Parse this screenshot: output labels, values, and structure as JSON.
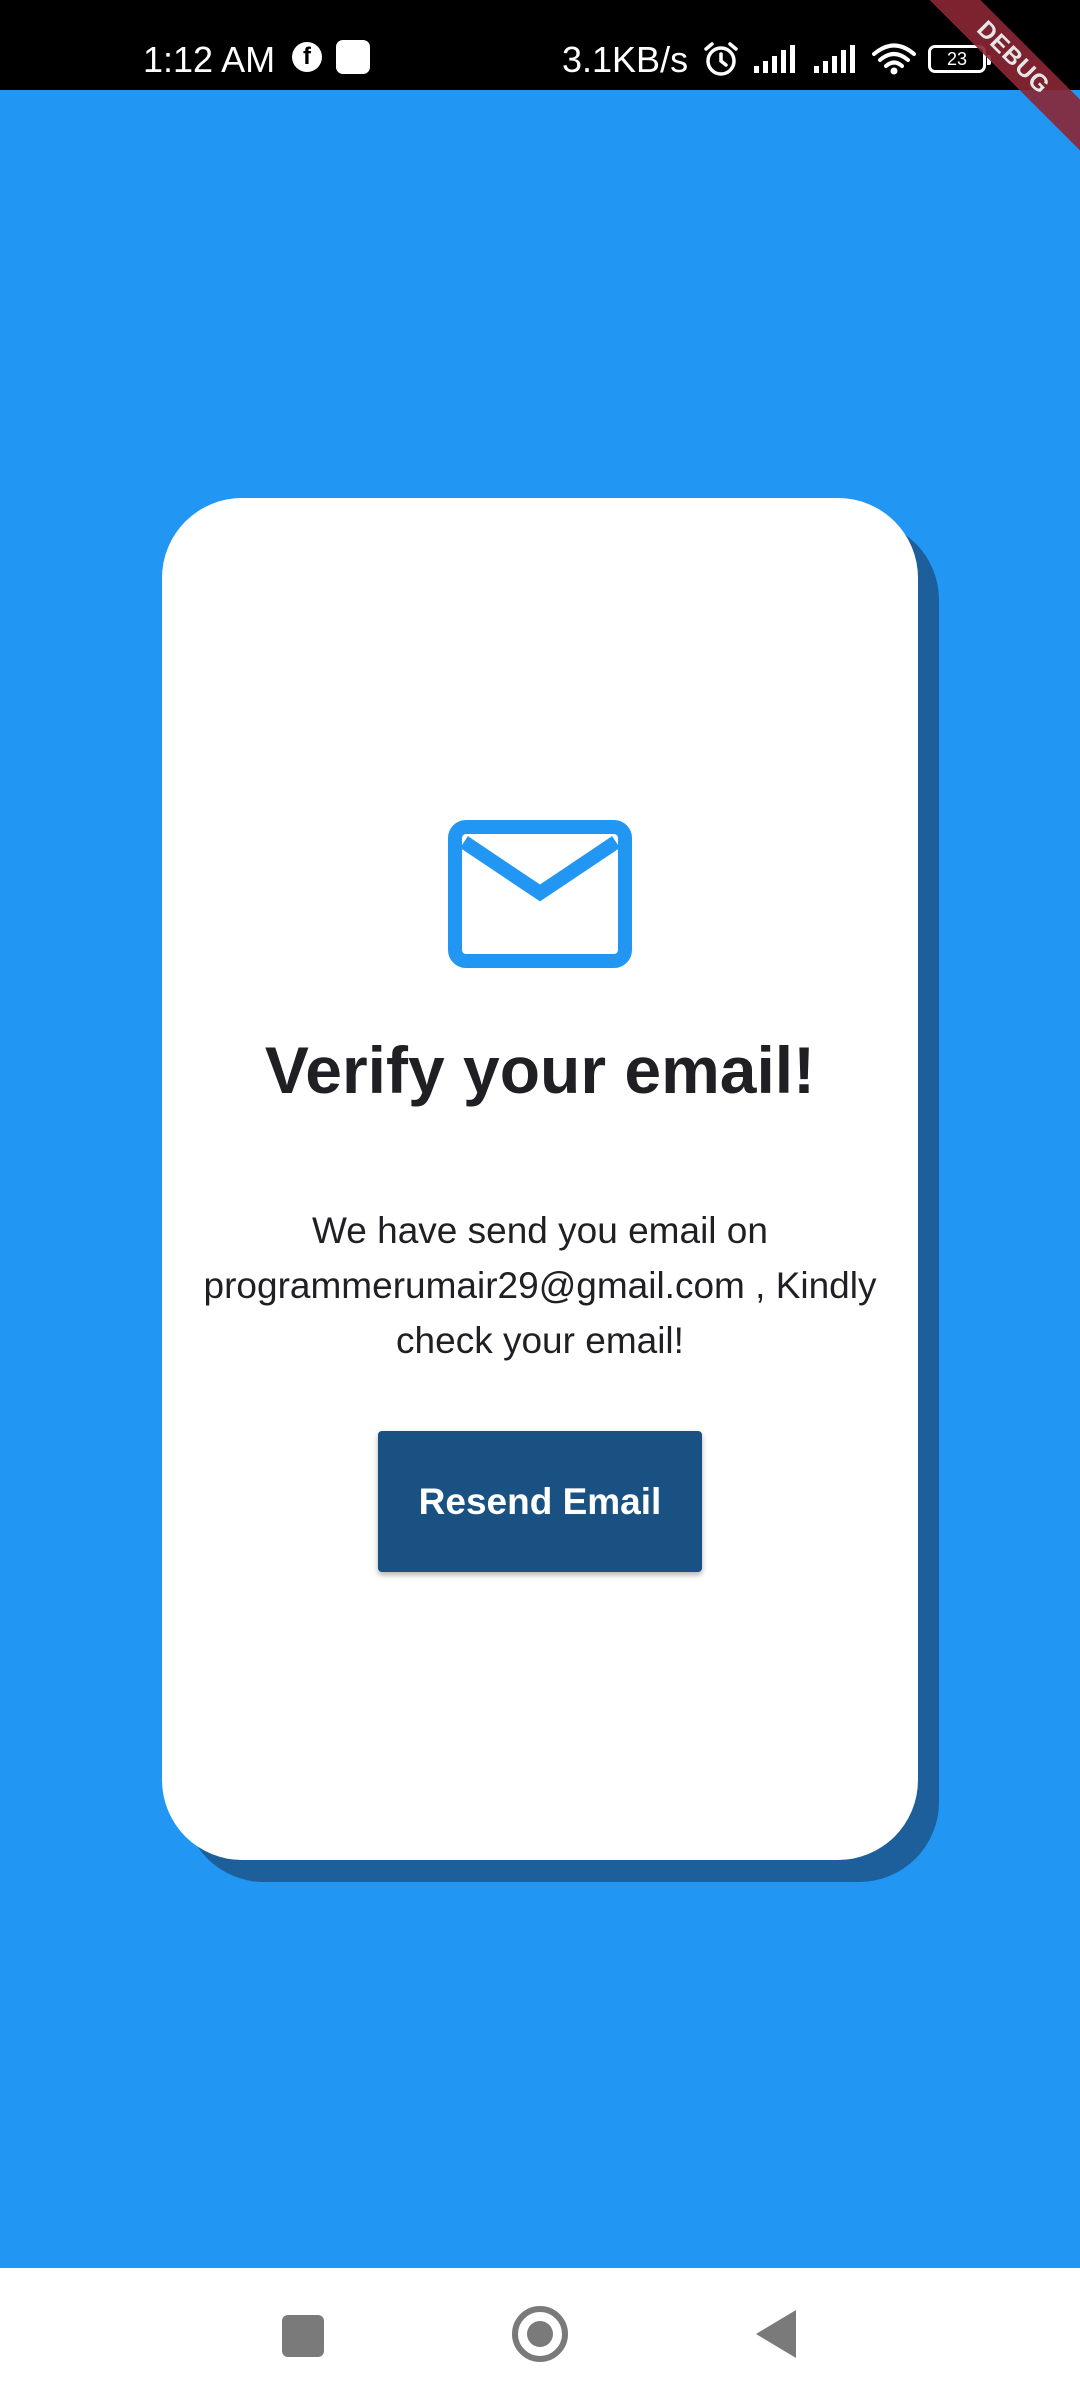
{
  "status_bar": {
    "time": "1:12 AM",
    "facebook_glyph": "f",
    "net_speed": "3.1KB/s",
    "battery_level": "23",
    "icons": [
      "facebook-icon",
      "app-notification-icon",
      "alarm-icon",
      "signal-icon",
      "signal-icon",
      "wifi-icon",
      "battery-icon"
    ]
  },
  "debug_banner": "DEBUG",
  "verify": {
    "icon": "mail-icon",
    "title": "Verify your email!",
    "message": "We have send you email on programmerumair29@gmail.com , Kindly check your email!",
    "resend_label": "Resend Email"
  },
  "nav_bar": {
    "icons": [
      "recent-apps-icon",
      "home-icon",
      "back-icon"
    ]
  },
  "colors": {
    "background": "#2196F3",
    "card": "#FFFFFF",
    "card_shadow": "#1C5F9A",
    "button": "#1A5183",
    "icon_accent": "#2196F3"
  }
}
